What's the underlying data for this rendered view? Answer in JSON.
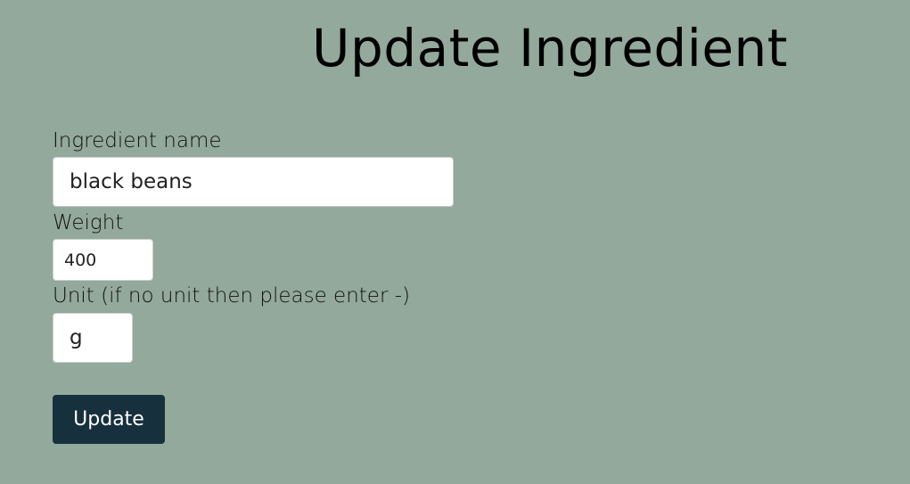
{
  "page": {
    "title": "Update Ingredient"
  },
  "form": {
    "name_label": "Ingredient name",
    "name_value": "black beans",
    "weight_label": "Weight",
    "weight_value": "400",
    "unit_label": "Unit (if no unit then please enter -)",
    "unit_value": "g",
    "submit_label": "Update"
  },
  "colors": {
    "background": "#93a99b",
    "button": "#17303d",
    "button_text": "#ffffff",
    "input_background": "#ffffff"
  }
}
